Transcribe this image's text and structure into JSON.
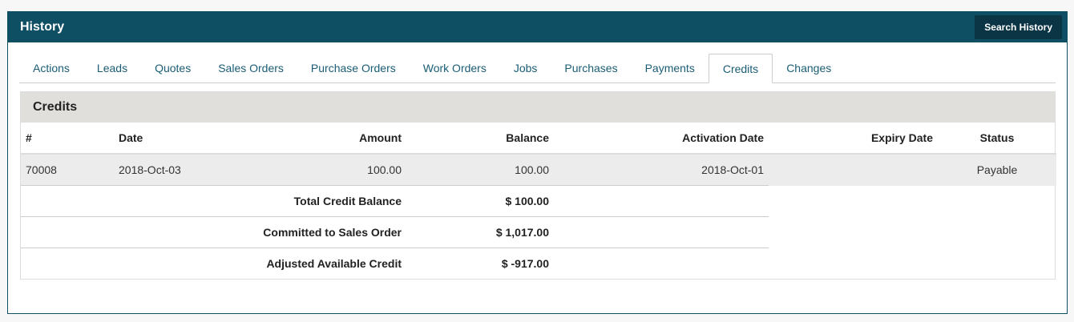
{
  "panel": {
    "title": "History",
    "search_label": "Search History"
  },
  "tabs": [
    {
      "label": "Actions"
    },
    {
      "label": "Leads"
    },
    {
      "label": "Quotes"
    },
    {
      "label": "Sales Orders"
    },
    {
      "label": "Purchase Orders"
    },
    {
      "label": "Work Orders"
    },
    {
      "label": "Jobs"
    },
    {
      "label": "Purchases"
    },
    {
      "label": "Payments"
    },
    {
      "label": "Credits"
    },
    {
      "label": "Changes"
    }
  ],
  "active_tab": "Credits",
  "credits": {
    "title": "Credits",
    "columns": [
      "#",
      "Date",
      "Amount",
      "Balance",
      "Activation Date",
      "Expiry Date",
      "Status"
    ],
    "rows": [
      {
        "num": "70008",
        "date": "2018-Oct-03",
        "amount": "100.00",
        "balance": "100.00",
        "activation": "2018-Oct-01",
        "expiry": "",
        "status": "Payable"
      }
    ],
    "summary": [
      {
        "label": "Total Credit Balance",
        "value": "$ 100.00"
      },
      {
        "label": "Committed to Sales Order",
        "value": "$ 1,017.00"
      },
      {
        "label": "Adjusted Available Credit",
        "value": "$ -917.00"
      }
    ]
  },
  "colors": {
    "header_bg": "#0e4f64",
    "tab_text": "#1a5d75",
    "section_bg": "#e0dfdb"
  }
}
